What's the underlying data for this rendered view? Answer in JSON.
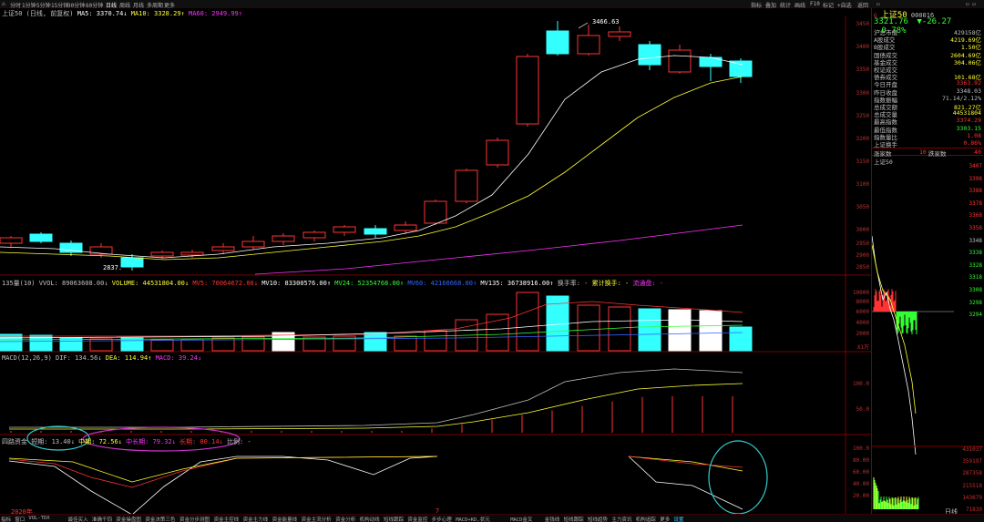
{
  "toolbar": {
    "periods": [
      "分时",
      "1分钟",
      "5分钟",
      "15分钟",
      "30分钟",
      "60分钟",
      "日线",
      "周线",
      "月线",
      "多周期",
      "更多"
    ],
    "active_period": "日线",
    "right_tools": [
      "指标",
      "叠加",
      "统计",
      "画线",
      "F10",
      "标记",
      "+自选",
      "返回"
    ]
  },
  "main_chart": {
    "title": "上证50 (日线, 前复权)",
    "ma5": "MA5: 3370.74↓",
    "ma10": "MA10: 3328.29↑",
    "ma60": "MA60: 2949.99↑",
    "high_label": "3466.63",
    "low_label": "2837.",
    "y_ticks": [
      "3450",
      "3400",
      "3350",
      "3300",
      "3250",
      "3200",
      "3150",
      "3100",
      "3050",
      "3000",
      "2950",
      "2900",
      "2850"
    ]
  },
  "volume_chart": {
    "legend": [
      {
        "text": "135量(10) VVOL: 89063608.00↓",
        "color": "#c0c0c0"
      },
      {
        "text": "VOLUME: 44531804.00↓",
        "color": "#ffff33"
      },
      {
        "text": "MV5: 70064672.00↓",
        "color": "#ff3333"
      },
      {
        "text": "MV10: 83300576.00↑",
        "color": "#ffffff"
      },
      {
        "text": "MV24: 52354768.00↑",
        "color": "#33ff33"
      },
      {
        "text": "MV60: 42160668.00↑",
        "color": "#3366ff"
      },
      {
        "text": "MV135: 36738916.00↑",
        "color": "#ffffff"
      },
      {
        "text": "换手率: -",
        "color": "#c0c0c0"
      },
      {
        "text": "累计换手: -",
        "color": "#ffff33"
      },
      {
        "text": "流通盘: -",
        "color": "#ff33ff"
      }
    ],
    "y_ticks": [
      "10000",
      "8000",
      "6000",
      "4000",
      "2000"
    ],
    "unit": "X1万"
  },
  "macd_chart": {
    "legend": [
      {
        "text": "MACD(12,26,9) DIF: 134.56↓",
        "color": "#c0c0c0"
      },
      {
        "text": "DEA: 114.94↑",
        "color": "#ffff33"
      },
      {
        "text": "MACD: 39.24↓",
        "color": "#ff33ff"
      }
    ],
    "y_ticks": [
      "100.0",
      "50.0"
    ]
  },
  "fund_chart": {
    "legend": [
      {
        "text": "四路资金 短期: 13.40↓",
        "color": "#c0c0c0"
      },
      {
        "text": "中期: 72.56↓",
        "color": "#ffff33"
      },
      {
        "text": "中长期: 79.32↓",
        "color": "#ff33ff"
      },
      {
        "text": "长期: 80.14↓",
        "color": "#ff3333"
      },
      {
        "text": "比例: -",
        "color": "#c0c0c0"
      }
    ],
    "y_ticks": [
      "100.0",
      "80.00",
      "60.00",
      "40.00",
      "20.00"
    ],
    "year_label": "2020年",
    "month_label": "7"
  },
  "quote_panel": {
    "name": "上证50",
    "code": "000016",
    "price": "3321.76",
    "change": "▼-26.27",
    "change_pct": "-0.78%",
    "rows": [
      {
        "k": "沪总市值",
        "v": "429158亿",
        "c": "#c0c0c0"
      },
      {
        "k": "A股成交",
        "v": "4219.69亿",
        "c": "#ffff33"
      },
      {
        "k": "B股成交",
        "v": "1.50亿",
        "c": "#ffff33"
      },
      {
        "k": "国债成交",
        "v": "2604.69亿",
        "c": "#ffff33"
      },
      {
        "k": "基金成交",
        "v": "304.06亿",
        "c": "#ffff33"
      },
      {
        "k": "权证成交",
        "v": "",
        "c": "#ffff33"
      },
      {
        "k": "债券成交",
        "v": "101.68亿",
        "c": "#ffff33"
      },
      {
        "k": "今日开盘",
        "v": "3363.92",
        "c": "#ff3333"
      },
      {
        "k": "昨日收盘",
        "v": "3348.03",
        "c": "#c0c0c0"
      },
      {
        "k": "指数振幅",
        "v": "71.14/2.12%",
        "c": "#c0c0c0"
      },
      {
        "k": "总成交额",
        "v": "821.27亿",
        "c": "#ffff33"
      },
      {
        "k": "总成交量",
        "v": "44531804",
        "c": "#ffff33"
      },
      {
        "k": "最高指数",
        "v": "3374.29",
        "c": "#ff3333"
      },
      {
        "k": "最低指数",
        "v": "3303.15",
        "c": "#33ff33"
      },
      {
        "k": "指数量比",
        "v": "1.08",
        "c": "#ff3333"
      },
      {
        "k": "上证换手",
        "v": "0.86%",
        "c": "#ff3333"
      }
    ],
    "breadth": {
      "up_label": "涨家数",
      "up": "40",
      "down": "10",
      "down_label": "跌家数"
    },
    "mini_title": "上证50",
    "mini_price_ticks": [
      "3407",
      "3398",
      "3388",
      "3378",
      "3368",
      "3358",
      "3348",
      "3338",
      "3328",
      "3318",
      "3308",
      "3298",
      "3294"
    ],
    "mini_vol_ticks": [
      "431037",
      "359197",
      "287358",
      "215518",
      "143679",
      "71839"
    ],
    "tab_label": "日线"
  },
  "bottom_tabs": [
    "指标",
    "窗口",
    "VOL-TDX",
    "最佳买入",
    "准确千钧",
    "资金操盘图",
    "资金决策三色",
    "资金分步测图",
    "资金主控线",
    "资金主力线",
    "资金能量线",
    "资金主流分析",
    "资金分析",
    "机构动线",
    "短线跟踪",
    "资金监控",
    "步步心理",
    "MACD+KD,状元",
    "MACD金叉",
    "金钱线",
    "短线跟踪",
    "短线趋势",
    "主力资讯",
    "机构追踪",
    "更多",
    "设置"
  ],
  "colors": {
    "up": "#ff3333",
    "down": "#33ffff",
    "ma5": "#ffffff",
    "ma10": "#ffff33",
    "ma60": "#ff33ff",
    "grid": "#7a0000",
    "background": "#000000",
    "annotation": "#33cccc"
  }
}
